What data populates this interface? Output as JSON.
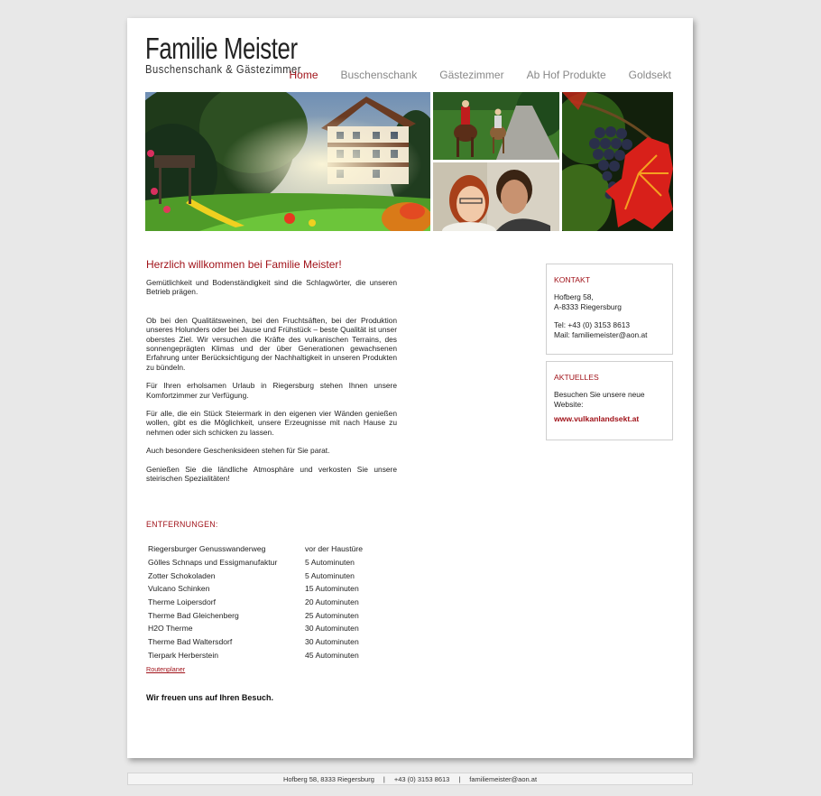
{
  "logo": {
    "title": "Familie Meister",
    "subtitle": "Buschenschank & Gästezimmer"
  },
  "nav": [
    {
      "label": "Home",
      "active": true
    },
    {
      "label": "Buschenschank",
      "active": false
    },
    {
      "label": "Gästezimmer",
      "active": false
    },
    {
      "label": "Ab Hof Produkte",
      "active": false
    },
    {
      "label": "Goldsekt",
      "active": false
    }
  ],
  "banner": {
    "photos": [
      "house-garden-photo",
      "horse-riders-photo",
      "couple-photo",
      "grapes-leaf-photo"
    ]
  },
  "welcome": {
    "title": "Herzlich willkommen bei Familie Meister!",
    "paragraphs": [
      "Gemütlichkeit und Bodenständigkeit sind die Schlagwörter, die unseren Betrieb prägen.",
      "Ob bei den Qualitätsweinen, bei den Fruchtsäften, bei der Produktion unseres Holunders oder bei Jause und Frühstück – beste Qualität ist unser oberstes Ziel. Wir versuchen die Kräfte des vulkanischen Terrains, des sonnengeprägten Klimas und der über Generationen gewachsenen Erfahrung unter Berücksichtigung der Nachhaltigkeit in unseren Produkten zu bündeln.",
      "Für Ihren erholsamen Urlaub in Riegersburg stehen Ihnen unsere Komfortzimmer zur Verfügung.",
      "Für alle, die ein Stück Steiermark in den eigenen vier Wänden genießen wollen, gibt es die Möglichkeit, unsere Erzeugnisse mit nach Hause zu nehmen oder sich schicken zu lassen.",
      "Auch besondere Geschenksideen stehen für Sie parat.",
      "Genießen Sie die ländliche Atmosphäre und verkosten Sie unsere steirischen Spezialitäten!"
    ]
  },
  "distances": {
    "title": "ENTFERNUNGEN:",
    "rows": [
      [
        "Riegersburger Genusswanderweg",
        "vor der Haustüre"
      ],
      [
        "Gölles Schnaps und Essigmanufaktur",
        "5 Autominuten"
      ],
      [
        "Zotter Schokoladen",
        "5 Autominuten"
      ],
      [
        "Vulcano Schinken",
        "15 Autominuten"
      ],
      [
        "Therme Loipersdorf",
        "20 Autominuten"
      ],
      [
        "Therme Bad Gleichenberg",
        "25 Autominuten"
      ],
      [
        "H2O Therme",
        "30 Autominuten"
      ],
      [
        "Therme Bad Waltersdorf",
        "30 Autominuten"
      ],
      [
        "Tierpark Herberstein",
        "45 Autominuten"
      ]
    ],
    "routen_link": "Routenplaner"
  },
  "closing": "Wir freuen uns auf Ihren Besuch.",
  "kontakt": {
    "title": "KONTAKT",
    "address1": "Hofberg 58,",
    "address2": "A-8333 Riegersburg",
    "tel": "Tel: +43 (0) 3153 8613",
    "mail": "Mail: familiemeister@aon.at"
  },
  "aktuelles": {
    "title": "AKTUELLES",
    "line1": "Besuchen Sie unsere neue",
    "line2": "Website:",
    "link": "www.vulkanlandsekt.at"
  },
  "footer": {
    "address": "Hofberg 58, 8333 Riegersburg",
    "sep": "|",
    "phone": "+43 (0) 3153 8613",
    "email": "familiemeister@aon.at"
  },
  "colors": {
    "accent": "#a1131a",
    "background": "#e8e8e8",
    "page": "#ffffff"
  }
}
